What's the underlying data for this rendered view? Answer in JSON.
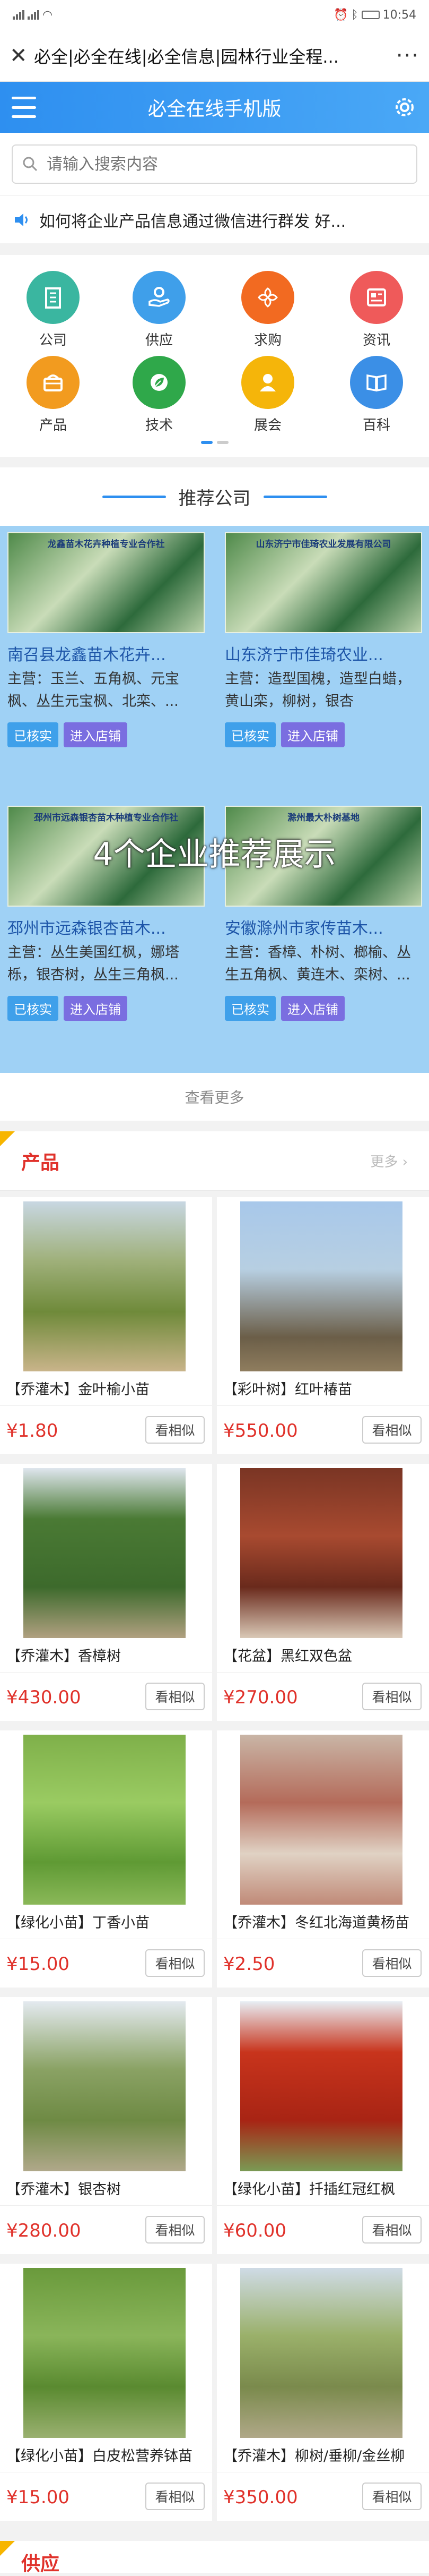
{
  "status_bar": {
    "time": "10:54",
    "icons": [
      "signal-icon",
      "wifi-icon",
      "alarm-icon",
      "bluetooth-icon",
      "battery-icon"
    ]
  },
  "titlebar": {
    "title": "必全|必全在线|必全信息|园林行业全程...",
    "more": "···"
  },
  "appbar": {
    "title": "必全在线手机版"
  },
  "search": {
    "placeholder": "请输入搜索内容"
  },
  "notice": {
    "text": "如何将企业产品信息通过微信进行群发 好..."
  },
  "categories": [
    {
      "label": "公司",
      "icon": "building-icon",
      "color": "#3ab6a0"
    },
    {
      "label": "供应",
      "icon": "supply-hand-icon",
      "color": "#3f9fea"
    },
    {
      "label": "求购",
      "icon": "purchase-icon",
      "color": "#f26a21"
    },
    {
      "label": "资讯",
      "icon": "news-icon",
      "color": "#ef5a5a"
    },
    {
      "label": "产品",
      "icon": "product-box-icon",
      "color": "#f29b1f"
    },
    {
      "label": "技术",
      "icon": "tech-leaf-icon",
      "color": "#2fa84a"
    },
    {
      "label": "展会",
      "icon": "exhibition-icon",
      "color": "#f5b50a"
    },
    {
      "label": "百科",
      "icon": "book-icon",
      "color": "#3b8fe6"
    }
  ],
  "recommend": {
    "title": "推荐公司",
    "overlay": "4个企业推荐展示",
    "see_more": "查看更多",
    "companies": [
      {
        "name": "南召县龙鑫苗木花卉...",
        "main": "主营：玉兰、五角枫、元宝枫、丛生元宝枫、北栾、...",
        "verified": "已核实",
        "enter": "进入店铺",
        "banner": "龙鑫苗木花卉种植专业合作社"
      },
      {
        "name": "山东济宁市佳琦农业...",
        "main": "主营：造型国槐，造型白蜡，黄山栾，柳树，银杏",
        "verified": "已核实",
        "enter": "进入店铺",
        "banner": "山东济宁市佳琦农业发展有限公司"
      },
      {
        "name": "邳州市远森银杏苗木...",
        "main": "主营：丛生美国红枫，娜塔栎，银杏树，丛生三角枫...",
        "verified": "已核实",
        "enter": "进入店铺",
        "banner": "邳州市远森银杏苗木种植专业合作社"
      },
      {
        "name": "安徽滁州市家传苗木...",
        "main": "主营：香樟、朴树、榔榆、丛生五角枫、黄连木、栾树、...",
        "verified": "已核实",
        "enter": "进入店铺",
        "banner": "滁州最大朴树基地"
      }
    ]
  },
  "products": {
    "title": "产品",
    "more": "更多",
    "similar_label": "看相似",
    "items": [
      {
        "name": "【乔灌木】金叶榆小苗",
        "price": "¥1.80"
      },
      {
        "name": "【彩叶树】红叶椿苗",
        "price": "¥550.00"
      },
      {
        "name": "【乔灌木】香樟树",
        "price": "¥430.00"
      },
      {
        "name": "【花盆】黑红双色盆",
        "price": "¥270.00"
      },
      {
        "name": "【绿化小苗】丁香小苗",
        "price": "¥15.00"
      },
      {
        "name": "【乔灌木】冬红北海道黄杨苗",
        "price": "¥2.50"
      },
      {
        "name": "【乔灌木】银杏树",
        "price": "¥280.00"
      },
      {
        "name": "【绿化小苗】扦插红冠红枫",
        "price": "¥60.00"
      },
      {
        "name": "【绿化小苗】白皮松营养钵苗",
        "price": "¥15.00"
      },
      {
        "name": "【乔灌木】柳树/垂柳/金丝柳",
        "price": "¥350.00"
      }
    ]
  },
  "supply": {
    "title": "供应"
  }
}
